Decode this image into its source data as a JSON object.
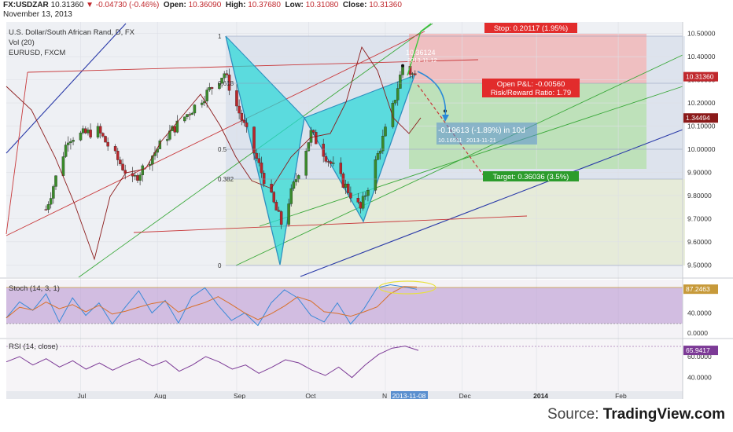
{
  "header": {
    "symbol": "FX:USDZAR",
    "last": "10.31360",
    "change": "-0.04730 (-0.46%)",
    "open_label": "Open:",
    "open": "10.36090",
    "high_label": "High:",
    "high": "10.37680",
    "low_label": "Low:",
    "low": "10.31080",
    "close_label": "Close:",
    "close": "10.31360",
    "date": "November 13, 2013"
  },
  "legends": {
    "main": "U.S. Dollar/South African Rand, D, FX",
    "vol": "Vol (20)",
    "compare": "EURUSD, FXCM",
    "stoch": "Stoch (14, 3, 1)",
    "rsi": "RSI (14, close)"
  },
  "source": {
    "prefix": "Source: ",
    "brand": "TradingView.com"
  },
  "colors": {
    "up": "#3a8a2a",
    "down": "#b8262b",
    "pattern_fill": "#28d8d8",
    "pattern_line": "#2d8fbf",
    "stop_zone": "#f2b8b8",
    "target_zone": "#b8e0b0",
    "stoch_band": "#b692d0",
    "rsi_line": "#7c3a96",
    "blue_line": "#2a3aa8",
    "green_line": "#3aa83a",
    "red_line": "#c8383a"
  },
  "chart_data": {
    "type": "candlestick",
    "title": "U.S. Dollar/South African Rand, D, FX",
    "symbol": "FX:USDZAR",
    "x_axis": {
      "tick_labels": [
        "Jul",
        "Aug",
        "Sep",
        "Oct",
        "N",
        "Dec",
        "2014",
        "Feb"
      ],
      "cursor_label": "2013-11-08"
    },
    "y_axis": {
      "ylim": [
        9.45,
        10.55
      ],
      "tick_labels": [
        "10.50000",
        "10.40000",
        "10.30000",
        "10.20000",
        "10.10000",
        "10.00000",
        "9.90000",
        "9.80000",
        "9.70000",
        "9.60000",
        "9.50000"
      ],
      "value_tags": [
        {
          "text": "10.31360",
          "value": 10.3136,
          "color": "#c0282d"
        },
        {
          "text": "1.34494",
          "value": 10.135,
          "color": "#8b1a1a"
        }
      ]
    },
    "price_series_approx": [
      {
        "date": "2013-06-17",
        "close": 9.74
      },
      {
        "date": "2013-06-26",
        "close": 10.05
      },
      {
        "date": "2013-07-08",
        "close": 10.08
      },
      {
        "date": "2013-07-22",
        "close": 9.86
      },
      {
        "date": "2013-08-05",
        "close": 10.06
      },
      {
        "date": "2013-08-19",
        "close": 10.22
      },
      {
        "date": "2013-08-28",
        "close": 10.33
      },
      {
        "date": "2013-09-12",
        "close": 9.9
      },
      {
        "date": "2013-09-20",
        "close": 9.68
      },
      {
        "date": "2013-10-02",
        "close": 10.07
      },
      {
        "date": "2013-10-22",
        "close": 9.74
      },
      {
        "date": "2013-11-04",
        "close": 10.18
      },
      {
        "date": "2013-11-08",
        "close": 10.3612
      },
      {
        "date": "2013-11-13",
        "close": 10.3136
      }
    ],
    "pattern_fib_labels": [
      "1",
      "0.618",
      "0.5",
      "0.382",
      "0"
    ],
    "annotations": [
      {
        "text": "Stop: 0.20117 (1.95%)",
        "price": 10.515
      },
      {
        "text": "10.36124",
        "price": 10.3612
      },
      {
        "text": "2013-11-12"
      },
      {
        "text": "Open P&L: -0.00560"
      },
      {
        "text": "Risk/Reward Ratio: 1.79"
      },
      {
        "text": "-0.19613 (-1.89%) in 10d"
      },
      {
        "text": "10.16511"
      },
      {
        "text": "2013-11-21"
      },
      {
        "text": "Target: 0.36036 (3.5%)",
        "price": 9.953
      }
    ],
    "long_position": {
      "entry": 10.3136,
      "stop": 10.515,
      "target": 9.953,
      "risk_reward": 1.79
    },
    "forecast_end": 10.16511,
    "panes": [
      {
        "name": "Stoch (14, 3, 1)",
        "ylim": [
          0,
          100
        ],
        "upper_band": 80,
        "lower_band": 20,
        "last_value": "87.2463",
        "tick_labels": [
          "40.0000",
          "0.0000"
        ],
        "series": [
          {
            "name": "%K",
            "values": [
              30,
              62,
              45,
              78,
              22,
              70,
              35,
              60,
              18,
              52,
              84,
              40,
              65,
              20,
              72,
              90,
              55,
              25,
              40,
              15,
              60,
              86,
              70,
              35,
              22,
              60,
              18,
              48,
              90,
              96,
              92,
              87
            ]
          }
        ]
      },
      {
        "name": "RSI (14, close)",
        "ylim": [
          30,
          75
        ],
        "last_value": "65.9417",
        "tick_labels": [
          "60.0000",
          "40.0000"
        ],
        "series": [
          {
            "name": "RSI",
            "values": [
              55,
              60,
              52,
              58,
              50,
              56,
              48,
              54,
              47,
              53,
              58,
              51,
              56,
              46,
              52,
              60,
              55,
              48,
              52,
              44,
              50,
              57,
              54,
              47,
              42,
              50,
              40,
              52,
              62,
              68,
              70,
              65.9
            ]
          }
        ]
      }
    ]
  }
}
